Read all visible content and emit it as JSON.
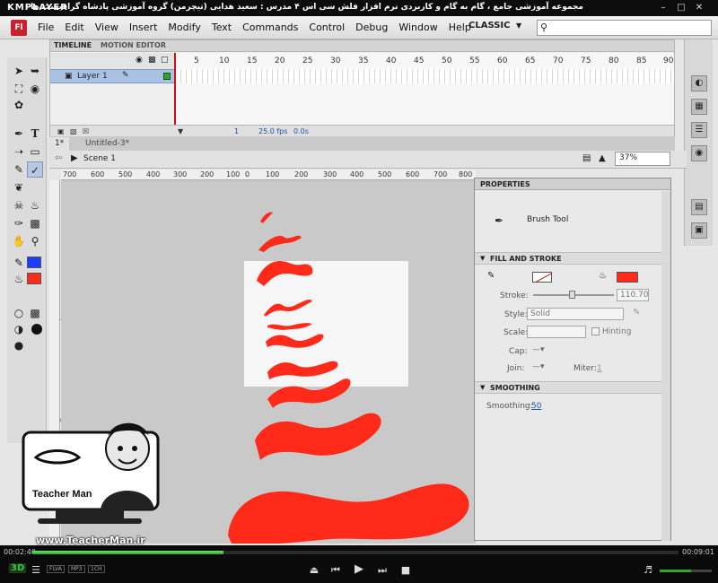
{
  "player": {
    "brand": "KMPLAYER",
    "window_title": "مجموعه آموزشی جامع ، گام به گام و کاربردی نرم افزار فلش سی اس ۴ مدرس : سعید هدایی (تیچرمن) گروه آموزشی پادشاه گرافیست ها",
    "elapsed": "00:02:40",
    "total": "00:09:01",
    "progress_fraction": 0.296,
    "volume_fraction": 0.6,
    "badges": [
      "FLVA",
      "MP3",
      "1CH"
    ],
    "mode_3d": "3D"
  },
  "app": {
    "logo": "Fl",
    "menus": [
      "File",
      "Edit",
      "View",
      "Insert",
      "Modify",
      "Text",
      "Commands",
      "Control",
      "Debug",
      "Window",
      "Help"
    ],
    "workspace": "CLASSIC",
    "search_placeholder": ""
  },
  "timeline": {
    "tab_timeline": "TIMELINE",
    "tab_motion": "MOTION EDITOR",
    "layer_name": "Layer 1",
    "frame_numbers": [
      "5",
      "10",
      "15",
      "20",
      "25",
      "30",
      "35",
      "40",
      "45",
      "50",
      "55",
      "60",
      "65",
      "70",
      "75",
      "80",
      "85",
      "90"
    ],
    "current_frame": "1",
    "fps": "25.0 fps",
    "time": "0.0s"
  },
  "documents": {
    "tabs": [
      "1*",
      "Untitled-3*"
    ],
    "scene": "Scene 1",
    "zoom": "37%"
  },
  "ruler": {
    "labels": [
      "700",
      "600",
      "500",
      "400",
      "300",
      "200",
      "100",
      "0",
      "100",
      "200",
      "300",
      "400",
      "500",
      "600",
      "700",
      "800"
    ]
  },
  "properties": {
    "panel_title": "PROPERTIES",
    "tool_name": "Brush Tool",
    "section_fill": "FILL AND STROKE",
    "stroke_label": "Stroke:",
    "stroke_value": "110.70",
    "style_label": "Style:",
    "style_value": "Solid",
    "scale_label": "Scale:",
    "hinting_label": "Hinting",
    "cap_label": "Cap:",
    "join_label": "Join:",
    "miter_label": "Miter:",
    "miter_value": "1",
    "section_smoothing": "SMOOTHING",
    "smoothing_label": "Smoothing:",
    "smoothing_value": "50",
    "fill_color": "#ff2a1a",
    "stroke_color": "#ffffff"
  },
  "colors": {
    "brush_red": "#ff2a1a",
    "stroke_swatch": "#1a3cff",
    "fill_swatch": "#ff2a1a"
  },
  "watermark": {
    "site": "www.TeacherMan.ir",
    "name_en": "Teacher Man"
  }
}
